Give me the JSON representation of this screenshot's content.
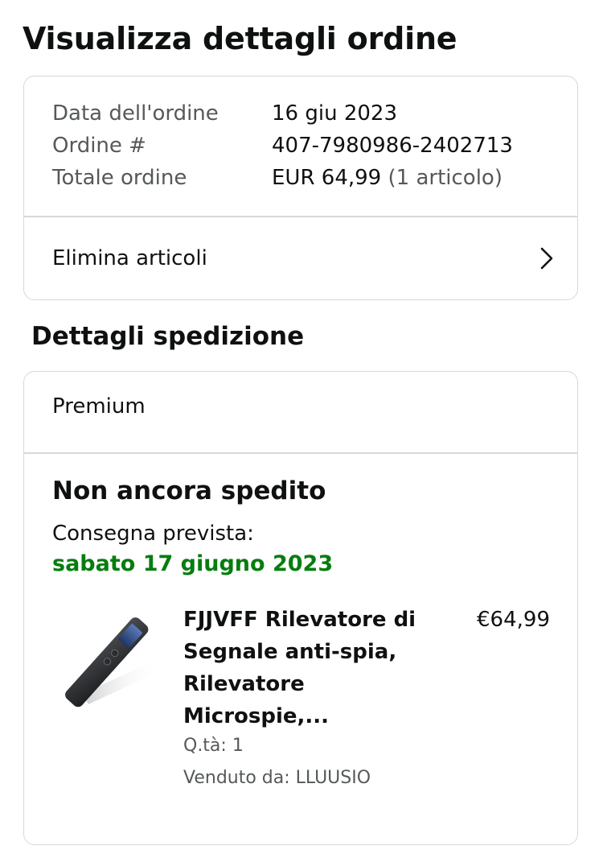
{
  "page": {
    "title": "Visualizza dettagli ordine"
  },
  "order_summary": {
    "rows": [
      {
        "label": "Data dell'ordine",
        "value": "16 giu 2023",
        "extra": ""
      },
      {
        "label": "Ordine #",
        "value": "407-7980986-2402713",
        "extra": ""
      },
      {
        "label": "Totale ordine",
        "value": "EUR 64,99",
        "extra": "(1 articolo)"
      }
    ],
    "delete_label": "Elimina articoli"
  },
  "shipment": {
    "section_title": "Dettagli spedizione",
    "type": "Premium",
    "status": "Non ancora spedito",
    "eta_label": "Consegna prevista:",
    "eta_date": "sabato 17 giugno 2023",
    "item": {
      "title": "FJJVFF Rilevatore di Segnale anti-spia, Rilevatore Microspie,...",
      "price": "€64,99",
      "quantity": "Q.tà: 1",
      "seller": "Venduto da: LLUUSIO",
      "image_icon": "signal-detector-device-icon"
    }
  },
  "colors": {
    "accent_green": "#067d0e",
    "muted_text": "#565959",
    "border": "#d5d9d9"
  }
}
